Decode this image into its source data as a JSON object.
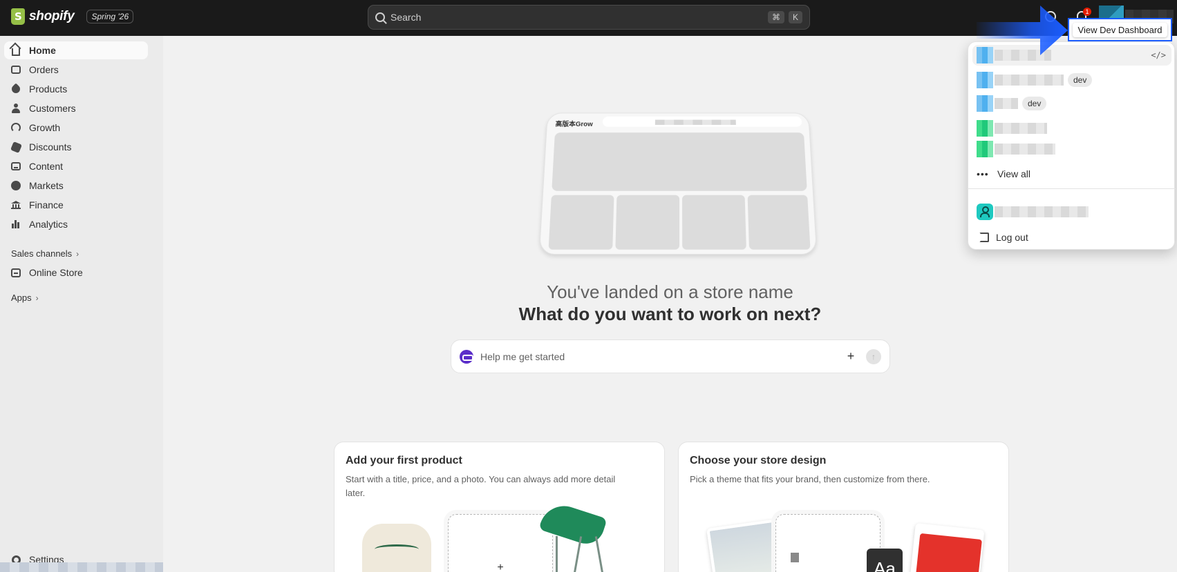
{
  "topbar": {
    "logo_text": "shopify",
    "edition": "Spring '26",
    "search_placeholder": "Search",
    "search_shortcut_1": "⌘",
    "search_shortcut_2": "K",
    "notification_count": "1"
  },
  "sidebar": {
    "items": [
      {
        "label": "Home",
        "icon": "home-icon"
      },
      {
        "label": "Orders",
        "icon": "inbox-icon"
      },
      {
        "label": "Products",
        "icon": "tag-icon"
      },
      {
        "label": "Customers",
        "icon": "person-icon"
      },
      {
        "label": "Growth",
        "icon": "gauge-icon"
      },
      {
        "label": "Discounts",
        "icon": "discount-icon"
      },
      {
        "label": "Content",
        "icon": "content-icon"
      },
      {
        "label": "Markets",
        "icon": "globe-icon"
      },
      {
        "label": "Finance",
        "icon": "bank-icon"
      },
      {
        "label": "Analytics",
        "icon": "bar-chart-icon"
      }
    ],
    "sales_channels_label": "Sales channels",
    "online_store_label": "Online Store",
    "apps_label": "Apps",
    "settings_label": "Settings"
  },
  "main": {
    "illustration_brand": "高版本Grow",
    "headline_1": "You've landed on a store name",
    "headline_2": "What do you want to work on next?",
    "prompt_placeholder": "Help me get started",
    "cards": [
      {
        "title": "Add your first product",
        "description": "Start with a title, price, and a photo. You can always add more detail later.",
        "dashed_symbol": "+"
      },
      {
        "title": "Choose your store design",
        "description": "Pick a theme that fits your brand, then customize from there.",
        "tile_text": "Aa"
      }
    ]
  },
  "account_menu": {
    "code_symbol": "</>",
    "dev_badge_1": "dev",
    "dev_badge_2": "dev",
    "view_all_label": "View all",
    "logout_label": "Log out"
  },
  "tooltip": {
    "label": "View Dev Dashboard"
  },
  "colors": {
    "topbar": "#1a1a1a",
    "sidebar": "#ebebeb",
    "annotation": "#1a5cff"
  }
}
